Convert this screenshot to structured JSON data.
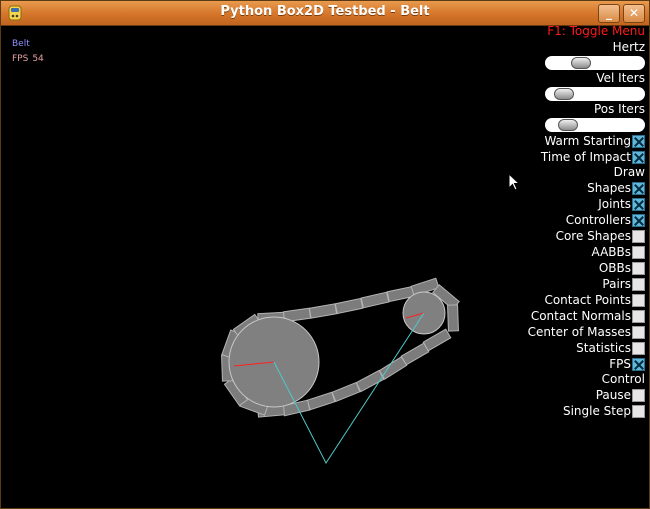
{
  "window": {
    "title": "Python Box2D Testbed - Belt",
    "minimize_glyph": "_",
    "close_glyph": "✕"
  },
  "hud": {
    "test_name": "Belt",
    "fps_label": "FPS",
    "fps_value": "54"
  },
  "menu": {
    "toggle_label": "F1: Toggle Menu",
    "sliders": [
      {
        "label": "Hertz",
        "value_fraction": 0.32
      },
      {
        "label": "Vel Iters",
        "value_fraction": 0.1
      },
      {
        "label": "Pos Iters",
        "value_fraction": 0.15
      }
    ],
    "checkboxes": [
      {
        "label": "Warm Starting",
        "checked": true
      },
      {
        "label": "Time of Impact",
        "checked": true
      }
    ],
    "draw_heading": "Draw",
    "draw_checkboxes": [
      {
        "label": "Shapes",
        "checked": true
      },
      {
        "label": "Joints",
        "checked": true
      },
      {
        "label": "Controllers",
        "checked": true
      },
      {
        "label": "Core Shapes",
        "checked": false
      },
      {
        "label": "AABBs",
        "checked": false
      },
      {
        "label": "OBBs",
        "checked": false
      },
      {
        "label": "Pairs",
        "checked": false
      },
      {
        "label": "Contact Points",
        "checked": false
      },
      {
        "label": "Contact Normals",
        "checked": false
      },
      {
        "label": "Center of Masses",
        "checked": false
      },
      {
        "label": "Statistics",
        "checked": false
      },
      {
        "label": "FPS",
        "checked": true
      }
    ],
    "control_heading": "Control",
    "control_checkboxes": [
      {
        "label": "Pause",
        "checked": false
      },
      {
        "label": "Single Step",
        "checked": false
      }
    ]
  },
  "colors": {
    "menu_title": "#ff1a1a",
    "test_label": "#8f8fff",
    "fps_label": "#e6a0a0",
    "joint": "#4fc8c8",
    "body": "#808080"
  },
  "icons": {
    "app": "python-app-icon",
    "cursor": "mouse-pointer-icon"
  }
}
